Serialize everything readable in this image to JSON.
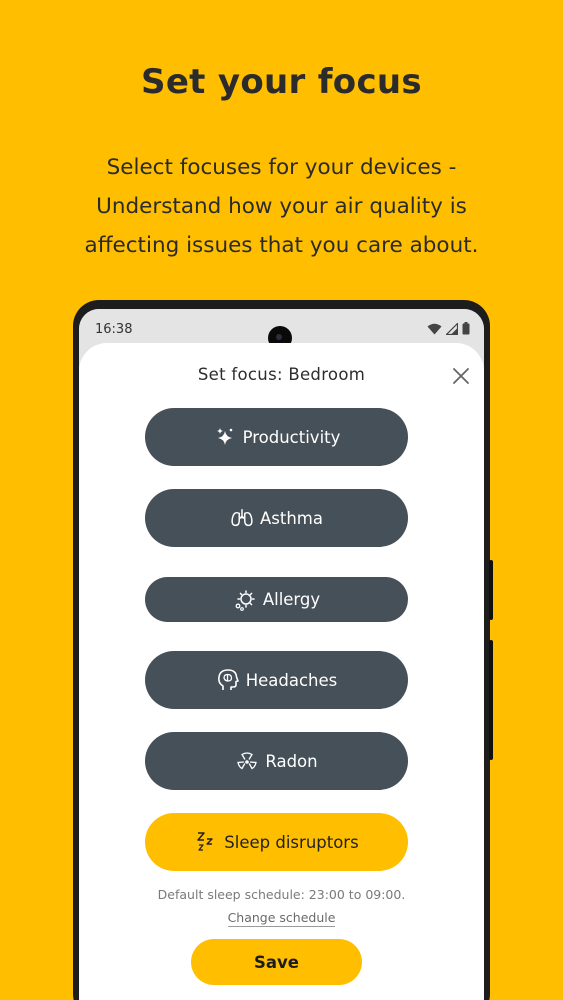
{
  "header": {
    "title": "Set your focus",
    "subtitle_lines": [
      "Select focuses for your devices -",
      "Understand how your air quality is",
      "affecting issues that you care about."
    ]
  },
  "status_bar": {
    "time": "16:38",
    "icons": [
      "wifi-icon",
      "signal-icon",
      "battery-icon"
    ]
  },
  "sheet": {
    "title": "Set focus: Bedroom",
    "close_icon": "close-icon",
    "options": [
      {
        "label": "Productivity",
        "icon": "sparkle-icon",
        "selected": false
      },
      {
        "label": "Asthma",
        "icon": "lungs-icon",
        "selected": false
      },
      {
        "label": "Allergy",
        "icon": "allergen-icon",
        "selected": false
      },
      {
        "label": "Headaches",
        "icon": "head-brain-icon",
        "selected": false
      },
      {
        "label": "Radon",
        "icon": "radiation-icon",
        "selected": false
      },
      {
        "label": "Sleep disruptors",
        "icon": "sleep-zzz-icon",
        "selected": true
      }
    ],
    "schedule_text": "Default sleep schedule: 23:00 to 09:00.",
    "change_schedule_label": "Change schedule",
    "save_label": "Save"
  },
  "colors": {
    "background": "#FFBE00",
    "button": "#465058",
    "selected": "#FFBE00"
  }
}
